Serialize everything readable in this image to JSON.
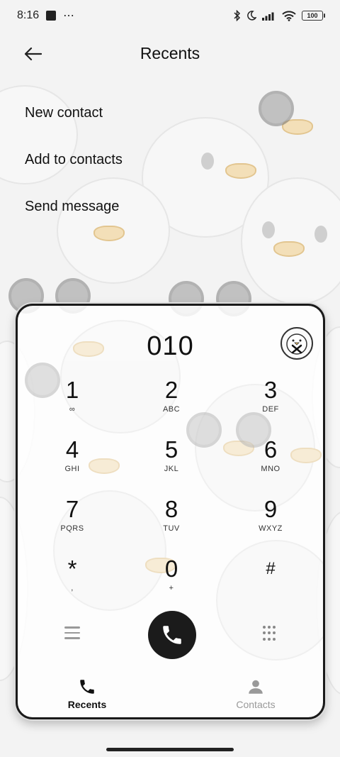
{
  "status_bar": {
    "time": "8:16",
    "more_indicator": "⋯",
    "battery": "100",
    "icons": [
      "notification-square-icon",
      "bluetooth-icon",
      "moon-icon",
      "signal-icon",
      "wifi-icon",
      "battery-icon"
    ]
  },
  "header": {
    "title": "Recents",
    "back_icon": "arrow-left-icon"
  },
  "menu": {
    "items": [
      "New contact",
      "Add to contacts",
      "Send message"
    ]
  },
  "dialer": {
    "number": "010",
    "delete_icon": "chick-delete-icon",
    "keys": [
      {
        "digit": "1",
        "letters": "∞"
      },
      {
        "digit": "2",
        "letters": "ABC"
      },
      {
        "digit": "3",
        "letters": "DEF"
      },
      {
        "digit": "4",
        "letters": "GHI"
      },
      {
        "digit": "5",
        "letters": "JKL"
      },
      {
        "digit": "6",
        "letters": "MNO"
      },
      {
        "digit": "7",
        "letters": "PQRS"
      },
      {
        "digit": "8",
        "letters": "TUV"
      },
      {
        "digit": "9",
        "letters": "WXYZ"
      },
      {
        "digit": "*",
        "letters": ","
      },
      {
        "digit": "0",
        "letters": "+"
      },
      {
        "digit": "#",
        "letters": ""
      }
    ],
    "call_icon": "phone-icon",
    "menu_icon": "menu-icon",
    "keypad_icon": "keypad-dots-icon"
  },
  "tabs": [
    {
      "label": "Recents",
      "icon": "phone-icon",
      "active": true
    },
    {
      "label": "Contacts",
      "icon": "person-icon",
      "active": false
    }
  ],
  "colors": {
    "call_button": "#1b1b1b",
    "inactive_tab": "#999999",
    "wallpaper_beak": "#f3dfb8"
  }
}
